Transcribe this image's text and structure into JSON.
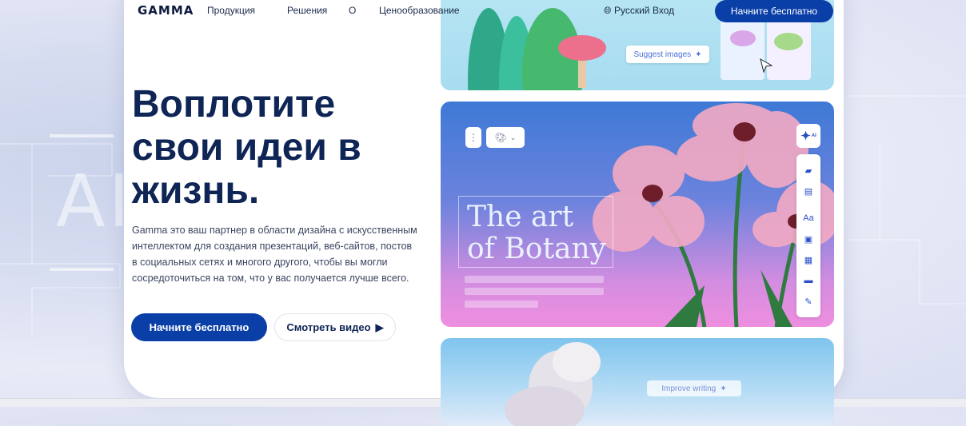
{
  "nav": {
    "logo": "GAMMA",
    "links": [
      "Продукция",
      "Решения",
      "О",
      "Ценообразование"
    ],
    "language": "Русский",
    "login": "Вход",
    "cta": "Начните бесплатно"
  },
  "hero": {
    "headline": "Воплотите свои идеи в жизнь.",
    "description": "Gamma это ваш партнер в области дизайна с искусственным интеллектом для создания презентаций, веб-сайтов, постов в социальных сетях и многого другого, чтобы вы могли сосредоточиться на том, что у вас получается лучше всего.",
    "primary_button": "Начните бесплатно",
    "secondary_button": "Смотреть видео"
  },
  "background": {
    "watermark": "AI"
  },
  "cards": {
    "top_pill": "Suggest images",
    "main_title_line1": "The art",
    "main_title_line2": "of Botany",
    "bottom_pill": "Improve writing",
    "ai_badge": "AI",
    "text_tool": "Aa"
  },
  "colors": {
    "primary": "#0b3fa8",
    "headline": "#0f2556"
  }
}
